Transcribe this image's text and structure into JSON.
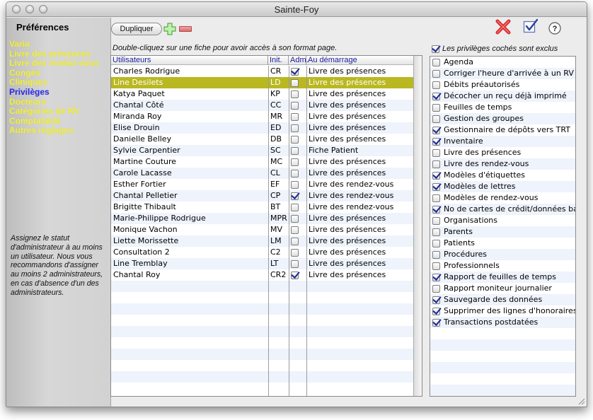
{
  "window": {
    "title": "Sainte-Foy"
  },
  "sidebar": {
    "title": "Préférences",
    "items": [
      {
        "label": "Varia",
        "active": false
      },
      {
        "label": "Livre des présences",
        "active": false
      },
      {
        "label": "Livre des rendez-vous",
        "active": false
      },
      {
        "label": "Congés",
        "active": false
      },
      {
        "label": "Cliniques",
        "active": false
      },
      {
        "label": "Privilèges",
        "active": true
      },
      {
        "label": "Docteurs",
        "active": false
      },
      {
        "label": "Catégories de RV",
        "active": false
      },
      {
        "label": "Comptabilité",
        "active": false
      },
      {
        "label": "Autres réglages",
        "active": false
      }
    ],
    "note": "Assignez le statut d'administrateur à au moins un utilisateur. Nous vous recommandons d'assigner au moins 2 administrateurs, en cas d'absence d'un des administrateurs."
  },
  "toolbar": {
    "duplicate_label": "Dupliquer",
    "add_icon": "plus-icon",
    "remove_icon": "minus-icon",
    "delete_icon": "red-x-icon",
    "validate_icon": "checkbox-check-icon",
    "help_icon": "question-mark-icon"
  },
  "users": {
    "hint": "Double-cliquez sur une fiche pour avoir accès à son format page.",
    "columns": [
      "Utilisateurs",
      "Init.",
      "Adm.",
      "Au démarrage"
    ],
    "rows": [
      {
        "name": "Charles Rodrigue",
        "init": "CR",
        "adm": true,
        "start": "Livre des présences"
      },
      {
        "name": "Line Desilets",
        "init": "LD",
        "adm": false,
        "start": "Livre des présences",
        "selected": true
      },
      {
        "name": "Katya Paquet",
        "init": "KP",
        "adm": false,
        "start": "Livre des présences"
      },
      {
        "name": "Chantal Côté",
        "init": "CC",
        "adm": false,
        "start": "Livre des présences"
      },
      {
        "name": "Miranda Roy",
        "init": "MR",
        "adm": false,
        "start": "Livre des présences"
      },
      {
        "name": "Elise Drouin",
        "init": "ED",
        "adm": false,
        "start": "Livre des présences"
      },
      {
        "name": "Danielle Belley",
        "init": "DB",
        "adm": false,
        "start": "Livre des présences"
      },
      {
        "name": "Sylvie Carpentier",
        "init": "SC",
        "adm": false,
        "start": "Fiche Patient"
      },
      {
        "name": "Martine Couture",
        "init": "MC",
        "adm": false,
        "start": "Livre des présences"
      },
      {
        "name": "Carole Lacasse",
        "init": "CL",
        "adm": false,
        "start": "Livre des présences"
      },
      {
        "name": "Esther Fortier",
        "init": "EF",
        "adm": false,
        "start": "Livre des rendez-vous"
      },
      {
        "name": "Chantal Pelletier",
        "init": "CP",
        "adm": true,
        "start": "Livre des rendez-vous"
      },
      {
        "name": "Brigitte Thibault",
        "init": "BT",
        "adm": false,
        "start": "Livre des rendez-vous"
      },
      {
        "name": "Marie-Philippe Rodrigue",
        "init": "MPR",
        "adm": false,
        "start": "Livre des présences"
      },
      {
        "name": "Monique Vachon",
        "init": "MV",
        "adm": false,
        "start": "Livre des présences"
      },
      {
        "name": "Liette Morissette",
        "init": "LM",
        "adm": false,
        "start": "Livre des présences"
      },
      {
        "name": "Consultation 2",
        "init": "C2",
        "adm": false,
        "start": "Livre des présences"
      },
      {
        "name": "Line Tremblay",
        "init": "LT",
        "adm": false,
        "start": "Livre des présences"
      },
      {
        "name": "Chantal Roy",
        "init": "CR2",
        "adm": true,
        "start": "Livre des présences"
      }
    ]
  },
  "privileges": {
    "excluded_label": "Les privilèges cochés sont exclus",
    "excluded_checked": true,
    "items": [
      {
        "label": "Agenda",
        "checked": false
      },
      {
        "label": "Corriger l'heure d'arrivée à un RV",
        "checked": false
      },
      {
        "label": "Débits préautorisés",
        "checked": false
      },
      {
        "label": "Décocher un reçu déjà imprimé",
        "checked": true
      },
      {
        "label": "Feuilles de temps",
        "checked": false
      },
      {
        "label": "Gestion des groupes",
        "checked": false
      },
      {
        "label": "Gestionnaire de dépôts vers TRT",
        "checked": true
      },
      {
        "label": "Inventaire",
        "checked": true
      },
      {
        "label": "Livre des présences",
        "checked": false
      },
      {
        "label": "Livre des rendez-vous",
        "checked": false
      },
      {
        "label": "Modèles d'étiquettes",
        "checked": true
      },
      {
        "label": "Modèles de lettres",
        "checked": true
      },
      {
        "label": "Modèles de rendez-vous",
        "checked": false
      },
      {
        "label": "No de cartes de crédit/données bancaires",
        "checked": true
      },
      {
        "label": "Organisations",
        "checked": false
      },
      {
        "label": "Parents",
        "checked": false
      },
      {
        "label": "Patients",
        "checked": false
      },
      {
        "label": "Procédures",
        "checked": false
      },
      {
        "label": "Professionnels",
        "checked": false
      },
      {
        "label": "Rapport de feuilles de temps",
        "checked": true
      },
      {
        "label": "Rapport moniteur journalier",
        "checked": false
      },
      {
        "label": "Sauvegarde des données",
        "checked": true
      },
      {
        "label": "Supprimer des lignes d'honoraires",
        "checked": true
      },
      {
        "label": "Transactions postdatées",
        "checked": true
      }
    ]
  }
}
